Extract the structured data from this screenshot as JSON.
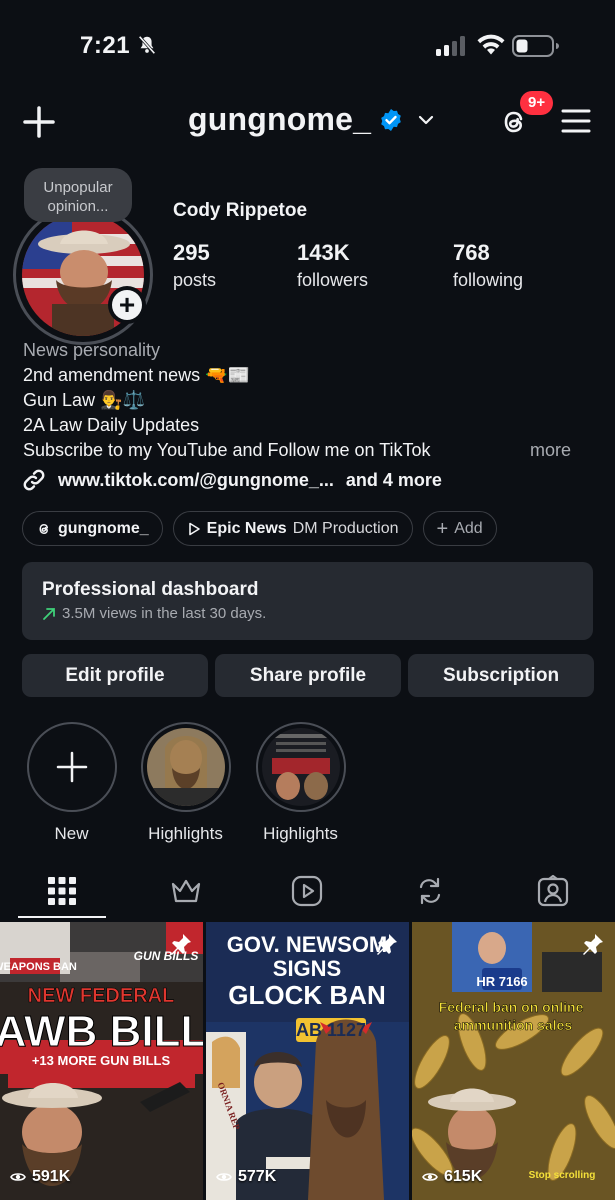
{
  "status_bar": {
    "time": "7:21"
  },
  "header": {
    "username": "gungnome_",
    "notification_badge": "9+"
  },
  "profile": {
    "note": "Unpopular opinion...",
    "display_name": "Cody Rippetoe",
    "stats": [
      {
        "value": "295",
        "label": "posts"
      },
      {
        "value": "143K",
        "label": "followers"
      },
      {
        "value": "768",
        "label": "following"
      }
    ]
  },
  "bio": {
    "category": "News personality",
    "lines": [
      "2nd amendment news 🔫📰",
      "Gun Law 👨‍⚖️⚖️",
      "2A Law Daily Updates",
      "Subscribe to my YouTube and Follow me on TikTok"
    ],
    "more": "more",
    "link": "www.tiktok.com/@gungnome_...",
    "link_more": "and 4 more"
  },
  "chips": {
    "threads_handle": "gungnome_",
    "page_name": "Epic News",
    "page_role": "DM Production",
    "add": "Add"
  },
  "dashboard": {
    "title": "Professional dashboard",
    "subtitle": "3.5M views in the last 30 days."
  },
  "buttons": {
    "edit": "Edit profile",
    "share": "Share profile",
    "subscription": "Subscription"
  },
  "highlights": [
    {
      "label": "New"
    },
    {
      "label": "Highlights"
    },
    {
      "label": "Highlights"
    }
  ],
  "posts": [
    {
      "views": "591K",
      "headline_top": "NEW FEDERAL",
      "headline_main": "AWB BILL",
      "headline_sub": "+13 MORE GUN BILLS",
      "tag": "GUN BILLS",
      "sign": "WEAPONS BAN"
    },
    {
      "views": "577K",
      "headline_lines": [
        "GOV. NEWSOM",
        "SIGNS",
        "GLOCK BAN"
      ],
      "bill": "AB 1127",
      "flag": "ORNIA REP"
    },
    {
      "views": "615K",
      "bill": "HR 7166",
      "headline": "Federal ban on online ammunition sales",
      "caption": "Stop scrolling"
    }
  ],
  "colors": {
    "background": "#0c0f14",
    "surface": "#262a31",
    "accent_blue": "#0095f6",
    "badge_red": "#ff3040",
    "trend_green": "#3fd17a"
  }
}
